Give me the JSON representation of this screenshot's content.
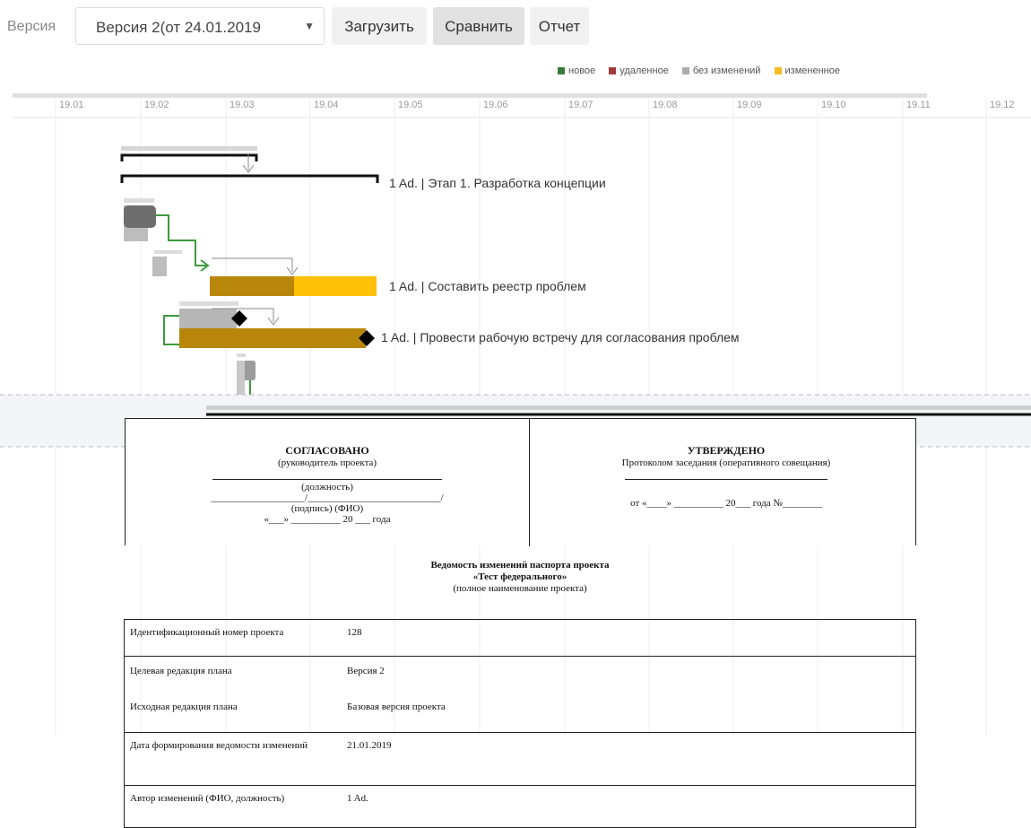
{
  "toolbar": {
    "version_label": "Версия",
    "version_selected": "Версия 2(от 24.01.2019",
    "load_label": "Загрузить",
    "compare_label": "Сравнить",
    "report_label": "Отчет"
  },
  "legend": [
    {
      "label": "новое",
      "color": "#3a7a3a"
    },
    {
      "label": "удаленное",
      "color": "#a33a3a"
    },
    {
      "label": "без изменений",
      "color": "#aaaaaa"
    },
    {
      "label": "измененное",
      "color": "#f5bd1f"
    }
  ],
  "timeline": [
    "19.01",
    "19.02",
    "19.03",
    "19.04",
    "19.05",
    "19.06",
    "19.07",
    "19.08",
    "19.09",
    "19.10",
    "19.11",
    "19.12"
  ],
  "gantt_tasks": [
    {
      "label": "1 Ad. | Этап 1. Разработка концепции"
    },
    {
      "label": "1 Ad. | Составить реестр проблем"
    },
    {
      "label": "1 Ad. | Провести рабочую встречу для согласования проблем"
    }
  ],
  "colors": {
    "bar_changed_dark": "#b8860b",
    "bar_changed_light": "#ffc107",
    "link_new": "#3c9a3c"
  },
  "document": {
    "left_title": "СОГЛАСОВАНО",
    "left_sub": "(руководитель проекта)",
    "left_position": "(должность)",
    "left_sign_line": "___________________/___________________________/",
    "left_sign": "(подпись) (ФИО)",
    "left_date": "«___» __________ 20 ___ года",
    "right_title": "УТВЕРЖДЕНО",
    "right_sub": "Протоколом заседания (оперативного совещания)",
    "right_date": "от «____» __________ 20___ года №________",
    "main_title": "Ведомость изменений паспорта проекта",
    "project_name": "«Тест федерального»",
    "project_note": "(полное наименование проекта)",
    "rows": [
      {
        "key": "Идентификационный номер проекта",
        "value": "128"
      },
      {
        "key": "Целевая редакция плана",
        "value": "Версия 2"
      },
      {
        "key": "Исходная редакция плана",
        "value": "Базовая версия проекта"
      },
      {
        "key": "Дата формирования ведомости изменений",
        "value": "21.01.2019"
      },
      {
        "key": "Автор изменений (ФИО, должность)",
        "value": "1 Ad."
      }
    ]
  }
}
